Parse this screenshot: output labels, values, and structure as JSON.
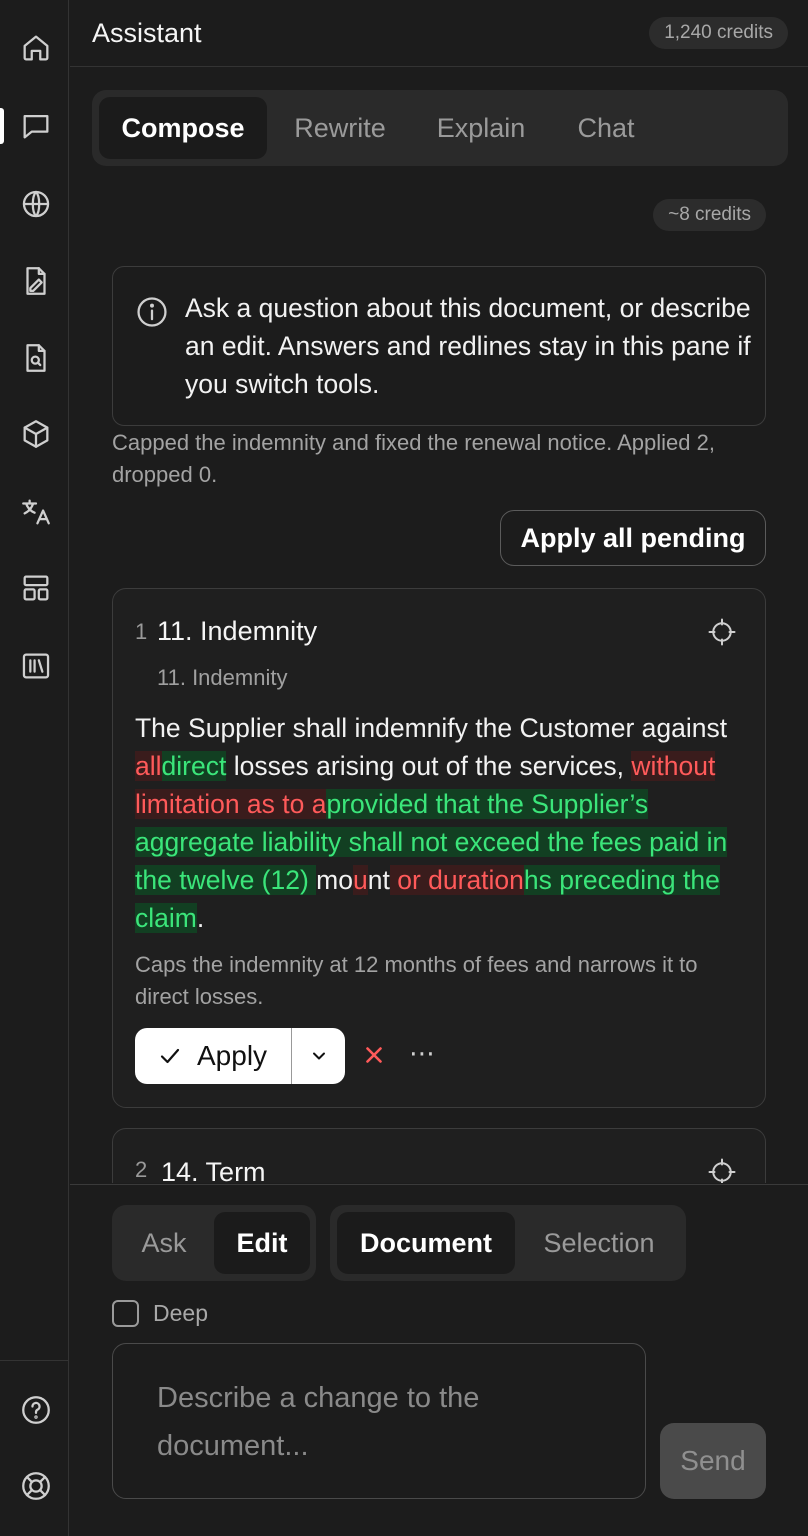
{
  "header": {
    "title": "Assistant",
    "credits": "1,240 credits"
  },
  "rail": {
    "icons": [
      "home-icon",
      "chat-icon",
      "globe-icon",
      "file-edit-icon",
      "file-search-icon",
      "cube-icon",
      "translate-icon",
      "layout-icon",
      "library-icon",
      "help-icon",
      "lifebuoy-icon"
    ],
    "active": "chat-icon"
  },
  "tabs": [
    {
      "label": "Compose",
      "active": true
    },
    {
      "label": "Rewrite",
      "active": false
    },
    {
      "label": "Explain",
      "active": false
    },
    {
      "label": "Chat",
      "active": false
    }
  ],
  "cost_estimate": "~8 credits",
  "info": {
    "text": "Ask a question about this document, or describe an edit. Answers and redlines stay in this pane if you switch tools."
  },
  "status": "Capped the indemnity and fixed the renewal notice. Applied 2, dropped 0.",
  "apply_all_label": "Apply all pending",
  "cards": [
    {
      "number": "1",
      "heading": "11. Indemnity",
      "section": "11. Indemnity",
      "redline": [
        {
          "t": "The Supplier shall indemnify the Customer against ",
          "k": "same"
        },
        {
          "t": "all",
          "k": "del"
        },
        {
          "t": "direct",
          "k": "ins"
        },
        {
          "t": " losses arising out of the services, ",
          "k": "same"
        },
        {
          "t": "without limitation as to a",
          "k": "del"
        },
        {
          "t": "provided that the Supplier’s aggregate liability shall not exceed the fees paid in the twelve (12) ",
          "k": "ins"
        },
        {
          "t": "mo",
          "k": "same"
        },
        {
          "t": "u",
          "k": "del"
        },
        {
          "t": "nt",
          "k": "same"
        },
        {
          "t": " or duration",
          "k": "del"
        },
        {
          "t": "hs preceding the claim",
          "k": "ins"
        },
        {
          "t": ".",
          "k": "same"
        }
      ],
      "explanation": "Caps the indemnity at 12 months of fees and narrows it to direct losses.",
      "apply_label": "Apply"
    },
    {
      "number": "2",
      "heading": "14. Term"
    }
  ],
  "mode": {
    "options": [
      {
        "label": "Ask",
        "active": false
      },
      {
        "label": "Edit",
        "active": true
      }
    ]
  },
  "scope": {
    "options": [
      {
        "label": "Document",
        "active": true
      },
      {
        "label": "Selection",
        "active": false
      }
    ]
  },
  "deep": {
    "label": "Deep",
    "checked": false
  },
  "composer": {
    "placeholder": "Describe a change to the document...",
    "send_label": "Send"
  },
  "colors": {
    "deleted": "#ff5a5a",
    "inserted": "#3be57a",
    "background": "#1c1c1c"
  }
}
